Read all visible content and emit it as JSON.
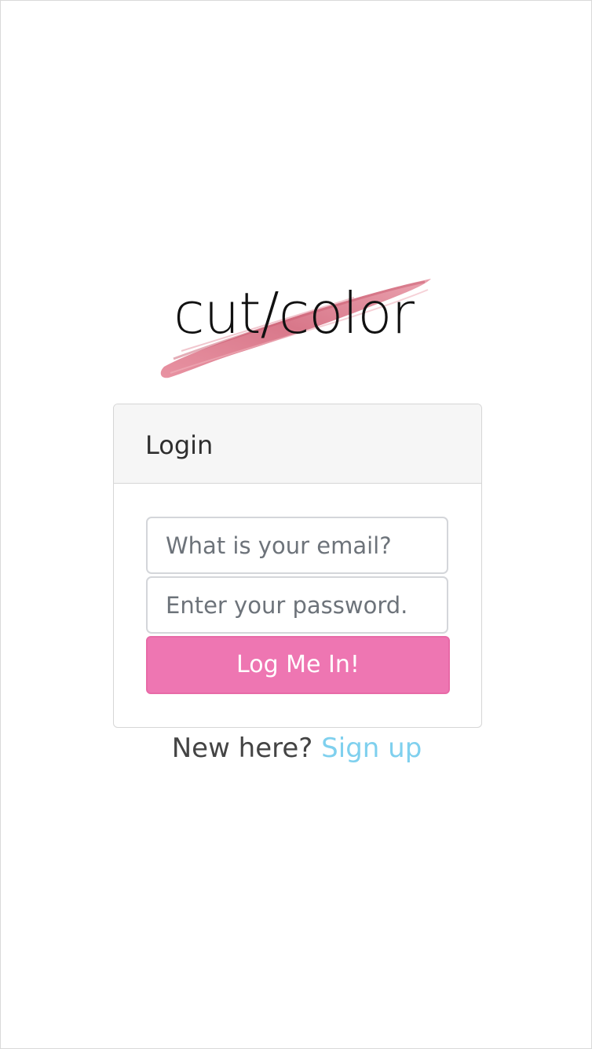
{
  "logo": {
    "text": "cut/color",
    "brush_color": "#d9748a"
  },
  "login_card": {
    "title": "Login",
    "email": {
      "placeholder": "What is your email?",
      "value": ""
    },
    "password": {
      "placeholder": "Enter your password.",
      "value": ""
    },
    "submit_label": "Log Me In!"
  },
  "signup": {
    "prompt": "New here?",
    "link_label": "Sign up"
  },
  "colors": {
    "accent_pink": "#ee76b2",
    "link_blue": "#7fd0ee",
    "header_bg": "#f6f6f6"
  }
}
